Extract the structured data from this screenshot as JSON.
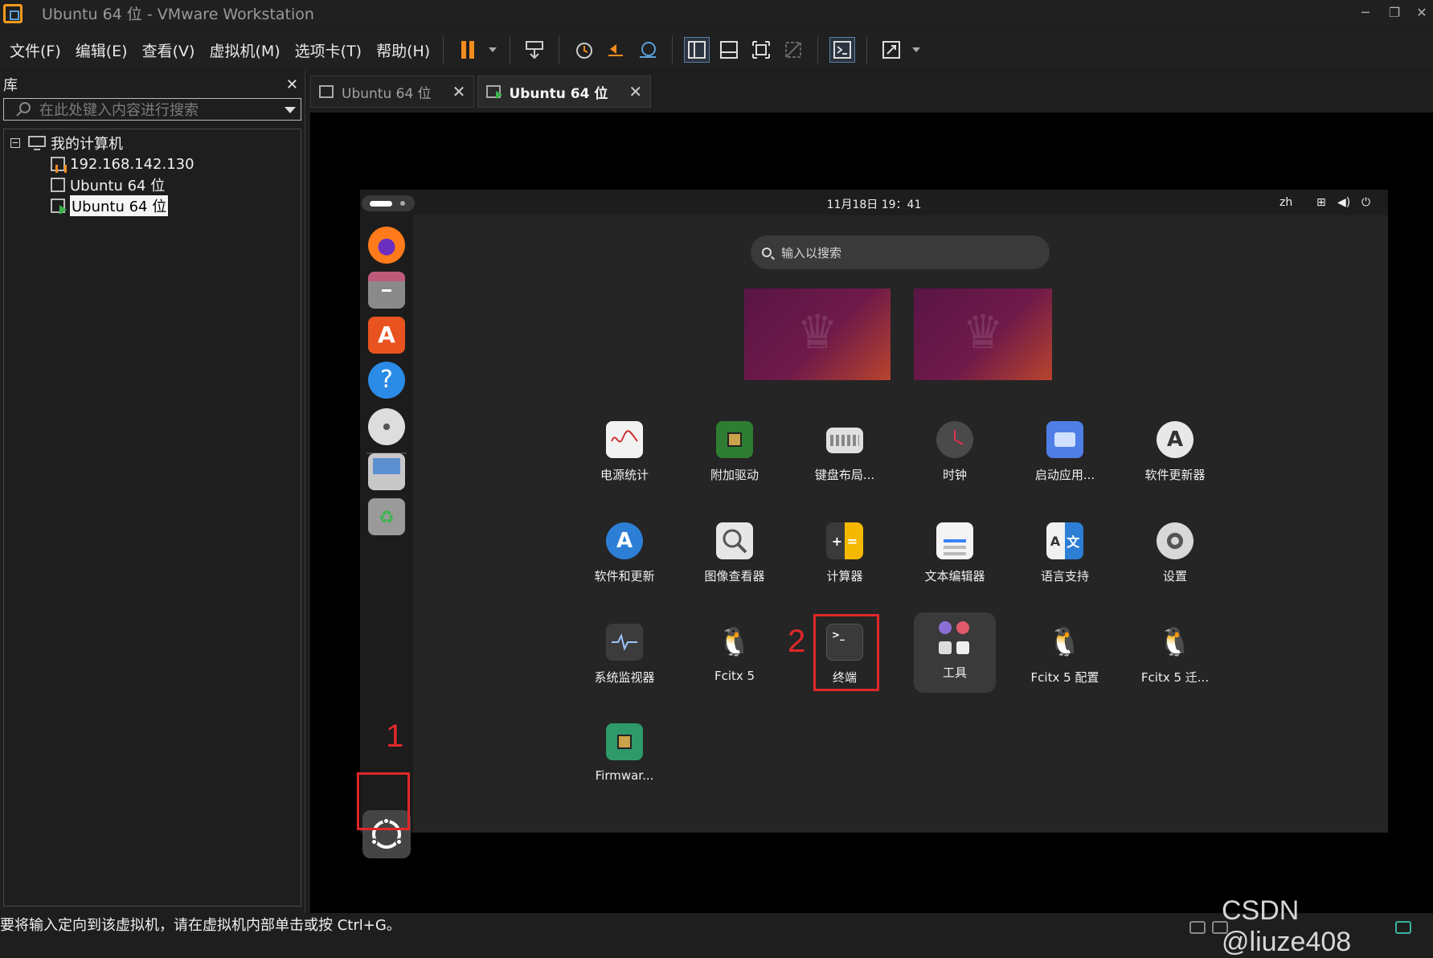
{
  "window": {
    "title": "Ubuntu 64 位 - VMware Workstation"
  },
  "menu": [
    "文件(F)",
    "编辑(E)",
    "查看(V)",
    "虚拟机(M)",
    "选项卡(T)",
    "帮助(H)"
  ],
  "library": {
    "title": "库",
    "search_placeholder": "在此处键入内容进行搜索",
    "root": "我的计算机",
    "items": [
      "192.168.142.130",
      "Ubuntu 64 位",
      "Ubuntu 64 位"
    ]
  },
  "tabs": [
    {
      "label": "Ubuntu 64 位",
      "active": false
    },
    {
      "label": "Ubuntu 64 位",
      "active": true
    }
  ],
  "guest": {
    "clock": "11月18日 19：41",
    "lang": "zh",
    "search_placeholder": "输入以搜索",
    "apps": [
      "电源统计",
      "附加驱动",
      "键盘布局...",
      "时钟",
      "启动应用...",
      "软件更新器",
      "软件和更新",
      "图像查看器",
      "计算器",
      "文本编辑器",
      "语言支持",
      "设置",
      "系统监视器",
      "Fcitx 5",
      "终端",
      "工具",
      "Fcitx 5 配置",
      "Fcitx 5 迁...",
      "Firmwar..."
    ]
  },
  "annotations": {
    "marker1": "1",
    "marker2": "2"
  },
  "status": {
    "text": "要将输入定向到该虚拟机，请在虚拟机内部单击或按 Ctrl+G。"
  },
  "watermark": "CSDN @liuze408",
  "colors": {
    "accent_orange": "#f28c1e",
    "annotation_red": "#e0282a",
    "run_green": "#3ab54a"
  }
}
